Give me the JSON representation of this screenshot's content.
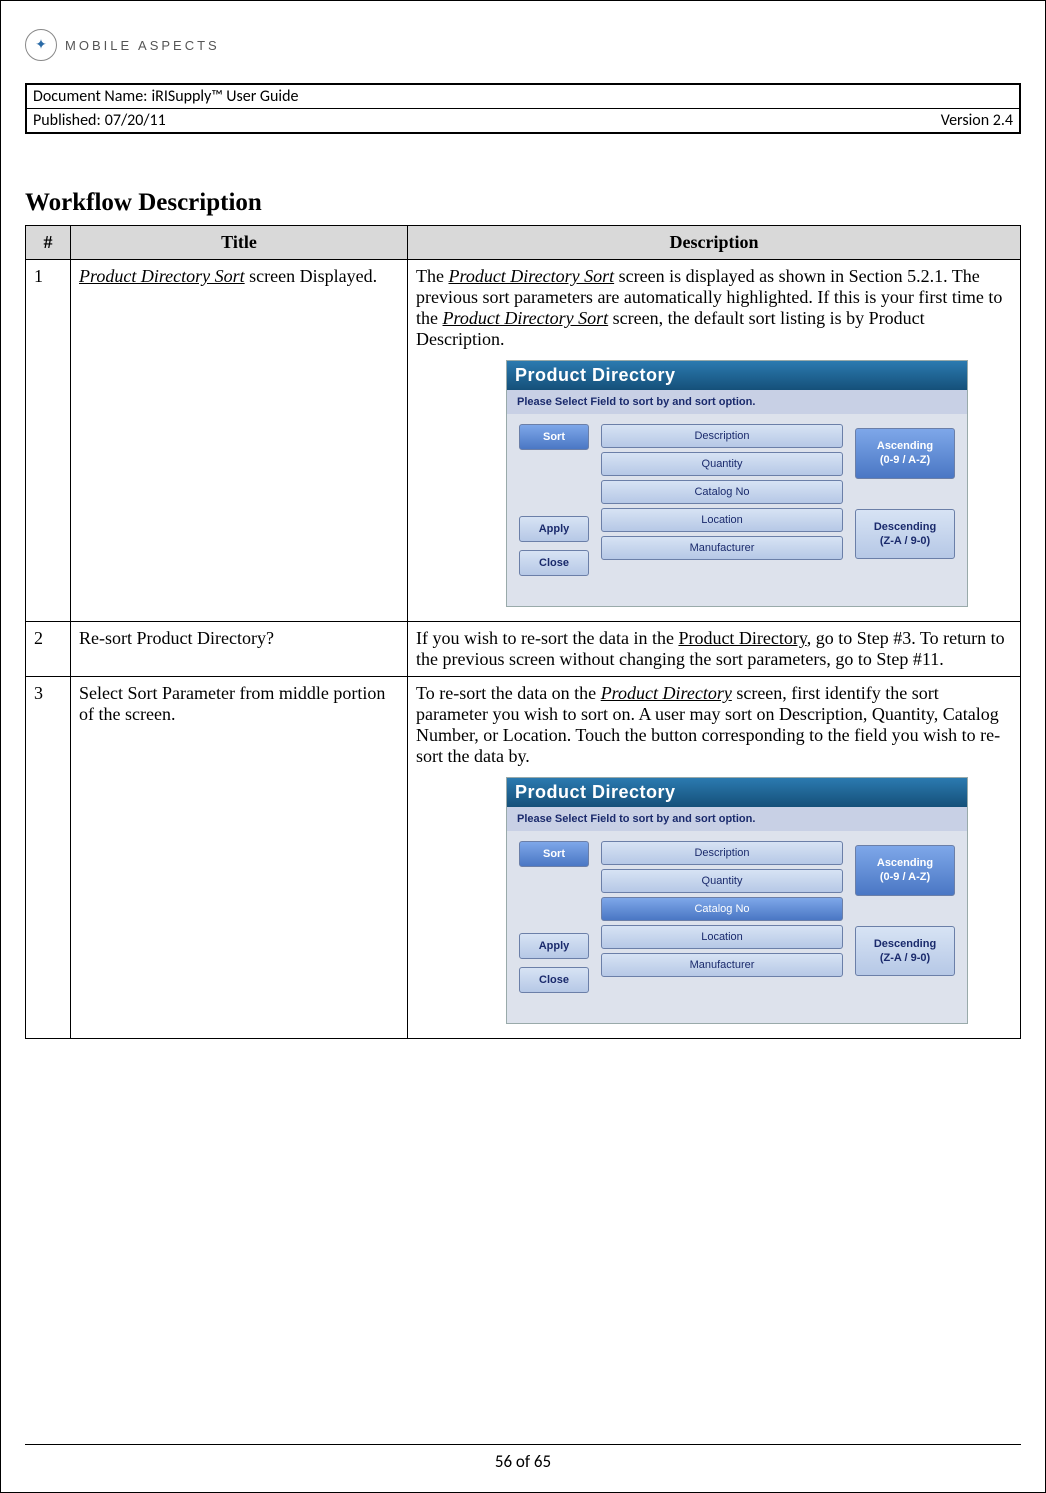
{
  "logo": {
    "text": "MOBILE ASPECTS"
  },
  "meta": {
    "doc_label": "Document Name:",
    "doc_value": "iRISupply™ User Guide",
    "pub_label": "Published:",
    "pub_value": "07/20/11",
    "version": "Version 2.4"
  },
  "heading": "Workflow Description",
  "table": {
    "headers": {
      "num": "#",
      "title": "Title",
      "desc": "Description"
    },
    "rows": [
      {
        "num": "1",
        "title_em": "Product Directory Sort",
        "title_rest": " screen Displayed.",
        "desc_pre": "The ",
        "desc_em1": "Product Directory Sort",
        "desc_mid1": " screen is displayed as shown in Section 5.2.1.  The previous sort parameters are automatically highlighted.  If this is your first time to the ",
        "desc_em2": "Product Directory Sort",
        "desc_post": " screen, the default sort listing is by Product Description."
      },
      {
        "num": "2",
        "title": "Re-sort Product Directory?",
        "desc_pre": "If you wish to re-sort the data in the ",
        "desc_u": "Product Directory",
        "desc_post": ", go to Step #3.  To return to the previous screen without changing the sort parameters, go to Step #11."
      },
      {
        "num": "3",
        "title": "Select Sort Parameter from middle portion of the screen.",
        "desc_pre": "To re-sort the data on the ",
        "desc_em": "Product Directory",
        "desc_post": " screen, first identify the sort parameter you wish to sort on.  A user may sort on Description, Quantity, Catalog Number, or Location.  Touch the button corresponding to the field you wish to re-sort the data by."
      }
    ]
  },
  "ui": {
    "title": "Product Directory",
    "prompt": "Please Select Field to sort by and sort option.",
    "sort": "Sort",
    "apply": "Apply",
    "close": "Close",
    "fields": [
      "Description",
      "Quantity",
      "Catalog No",
      "Location",
      "Manufacturer"
    ],
    "asc_l1": "Ascending",
    "asc_l2": "(0-9 / A-Z)",
    "desc_l1": "Descending",
    "desc_l2": "(Z-A / 9-0)"
  },
  "footer": "56 of 65"
}
